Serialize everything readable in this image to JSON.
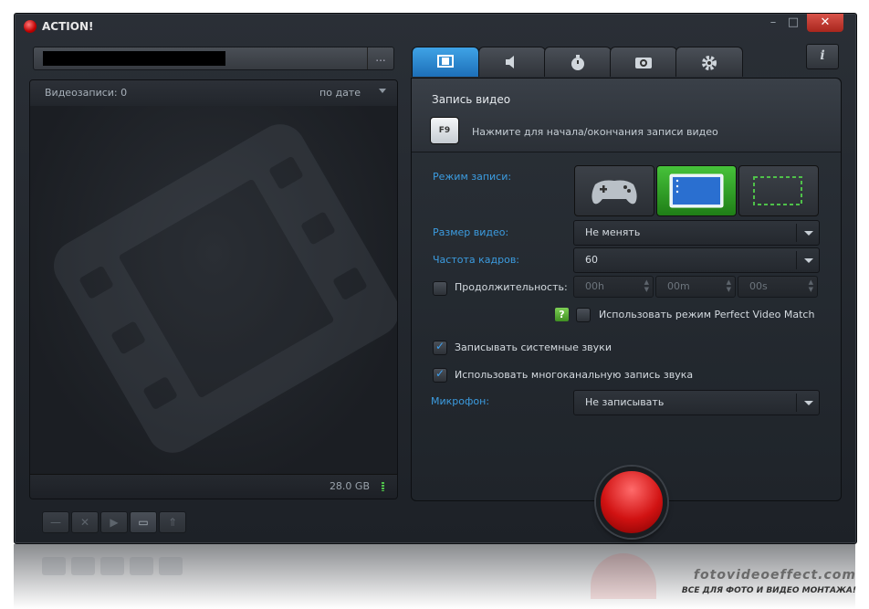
{
  "app": {
    "title": "ACTION!"
  },
  "window": {
    "minimize": "–",
    "maximize": "□",
    "close": "✕"
  },
  "filebar": {
    "dots": "..."
  },
  "list": {
    "count_label": "Видеозаписи: 0",
    "sort_label": "по дате",
    "disk_free": "28.0 GB"
  },
  "bottom_buttons": [
    {
      "name": "remove",
      "glyph": "—"
    },
    {
      "name": "delete",
      "glyph": "✕"
    },
    {
      "name": "play",
      "glyph": "▶"
    },
    {
      "name": "open-folder",
      "glyph": "▭"
    },
    {
      "name": "upload",
      "glyph": "⇑"
    }
  ],
  "tabs": [
    "video-tab",
    "audio-tab",
    "benchmark-tab",
    "screenshot-tab",
    "settings-tab"
  ],
  "info_button": "i",
  "panel": {
    "section_title": "Запись видео",
    "hotkey": "F9",
    "hotkey_desc": "Нажмите для начала/окончания записи видео",
    "mode_label": "Режим записи:",
    "size_label": "Размер видео:",
    "size_value": "Не менять",
    "fps_label": "Частота кадров:",
    "fps_value": "60",
    "duration_label": "Продолжительность:",
    "duration_h": "00h",
    "duration_m": "00m",
    "duration_s": "00s",
    "help": "?",
    "perfect_match": "Использовать режим Perfect Video Match",
    "system_sounds": "Записывать системные звуки",
    "multichannel": "Использовать многоканальную запись звука",
    "mic_label": "Микрофон:",
    "mic_value": "Не записывать"
  },
  "colors": {
    "accent": "#3c9ce0",
    "active_mode": "#2fa326",
    "record": "#d11212"
  },
  "watermark": {
    "site": "fotovideoeffect.com",
    "slogan": "ВСЕ ДЛЯ ФОТО И ВИДЕО МОНТАЖА!"
  }
}
